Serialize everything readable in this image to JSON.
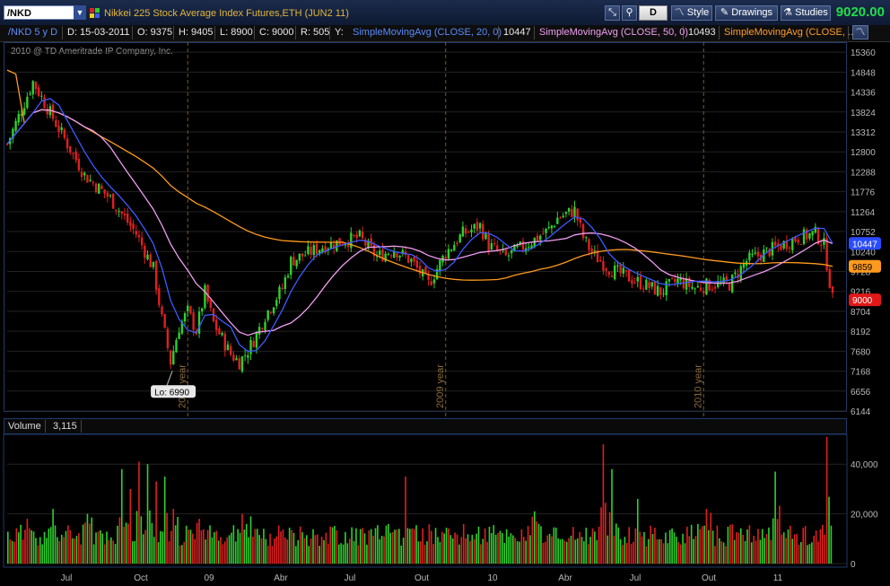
{
  "header": {
    "symbol": "/NKD",
    "title": "Nikkei 225 Stock Average Index Futures,ETH (JUN2 11)",
    "d_label": "D",
    "style_label": "Style",
    "drawings_label": "Drawings",
    "studies_label": "Studies",
    "last_price": "9020.00"
  },
  "info": {
    "period": "/NKD 5 y D",
    "date": "D: 15-03-2011",
    "open": "O: 9375",
    "high": "H: 9405",
    "low": "L: 8900",
    "close": "C: 9000",
    "range": "R: 505",
    "y": "Y:",
    "sma20_label": "SimpleMovingAvg (CLOSE, 20, 0)",
    "sma20_value": "10447",
    "sma50_label": "SimpleMovingAvg (CLOSE, 50, 0)",
    "sma50_value": "10493",
    "sma200_label": "SimpleMovingAvg (CLOSE, ..."
  },
  "copyright": "2010 @ TD Ameritrade IP Company, Inc.",
  "volume": {
    "label": "Volume",
    "value": "3,115"
  },
  "colors": {
    "up": "#2fd02f",
    "down": "#e02020",
    "sma20": "#3b5bff",
    "sma50": "#f09cf0",
    "sma200": "#ff9a1e",
    "grid": "#232323",
    "year_line": "#7a5a2a"
  },
  "chart_data": {
    "type": "candlestick",
    "price_axis_ticks": [
      6144,
      6656,
      7168,
      7680,
      8192,
      8704,
      9216,
      9728,
      10240,
      10752,
      11264,
      11776,
      12288,
      12800,
      13312,
      13824,
      14336,
      14848,
      15360
    ],
    "price_ylim": [
      6144,
      15616
    ],
    "x_ticks": [
      "Jul",
      "Oct",
      "09",
      "Abr",
      "Jul",
      "Out",
      "10",
      "Abr",
      "Jul",
      "Out",
      "11"
    ],
    "year_markers": [
      "2008 year",
      "2009 year",
      "2010 year"
    ],
    "low_annotation": "Lo: 6990",
    "close_key": [
      [
        0,
        13000
      ],
      [
        3,
        14600
      ],
      [
        6,
        13400
      ],
      [
        9,
        12200
      ],
      [
        12,
        11600
      ],
      [
        15,
        10700
      ],
      [
        17,
        9800
      ],
      [
        18,
        8500
      ],
      [
        19,
        7400
      ],
      [
        20,
        8300
      ],
      [
        21,
        8700
      ],
      [
        22,
        8200
      ],
      [
        23,
        9200
      ],
      [
        24,
        8400
      ],
      [
        25,
        8000
      ],
      [
        26,
        7600
      ],
      [
        27,
        7400
      ],
      [
        28,
        7700
      ],
      [
        29,
        8100
      ],
      [
        30,
        8600
      ],
      [
        32,
        9300
      ],
      [
        33,
        10000
      ],
      [
        35,
        10200
      ],
      [
        37,
        10400
      ],
      [
        39,
        10500
      ],
      [
        41,
        10600
      ],
      [
        43,
        10100
      ],
      [
        45,
        10300
      ],
      [
        47,
        10000
      ],
      [
        49,
        9400
      ],
      [
        51,
        10200
      ],
      [
        53,
        10700
      ],
      [
        55,
        10900
      ],
      [
        56,
        10400
      ],
      [
        58,
        10100
      ],
      [
        61,
        10500
      ],
      [
        63,
        10800
      ],
      [
        64,
        11100
      ],
      [
        66,
        11300
      ],
      [
        67,
        10600
      ],
      [
        68,
        10200
      ],
      [
        70,
        9800
      ],
      [
        72,
        9600
      ],
      [
        74,
        9400
      ],
      [
        76,
        9200
      ],
      [
        78,
        9500
      ],
      [
        80,
        9300
      ],
      [
        82,
        9400
      ],
      [
        84,
        9400
      ],
      [
        86,
        10000
      ],
      [
        88,
        10200
      ],
      [
        90,
        10400
      ],
      [
        92,
        10600
      ],
      [
        94,
        10700
      ],
      [
        95,
        10400
      ],
      [
        96,
        9000
      ]
    ],
    "sma20_last": 10447,
    "sma50_last": 10493,
    "sma200_last": 9859,
    "last_close": 9000,
    "price_labels": [
      {
        "value": 10447,
        "color": "#2a4cff",
        "text": "10447"
      },
      {
        "value": 9859,
        "color": "#ff9a1e",
        "text": "9859"
      },
      {
        "value": 9000,
        "color": "#e01818",
        "text": "9000"
      }
    ],
    "volume_ticks": [
      {
        "value": 0,
        "label": "0"
      },
      {
        "value": 20000,
        "label": "20,000"
      },
      {
        "value": 40000,
        "label": "40,000"
      }
    ],
    "volume_ylim": [
      0,
      52000
    ],
    "volume_spikes": [
      [
        2,
        18000
      ],
      [
        5,
        22000
      ],
      [
        9,
        20000
      ],
      [
        13,
        38000
      ],
      [
        14,
        30000
      ],
      [
        15,
        41000
      ],
      [
        16,
        40000
      ],
      [
        17,
        33000
      ],
      [
        18,
        35000
      ],
      [
        19,
        22000
      ],
      [
        22,
        18000
      ],
      [
        27,
        20000
      ],
      [
        28,
        19000
      ],
      [
        46,
        35000
      ],
      [
        61,
        21000
      ],
      [
        69,
        48000
      ],
      [
        70,
        38000
      ],
      [
        73,
        26000
      ],
      [
        81,
        22000
      ],
      [
        89,
        37000
      ],
      [
        95,
        51000
      ],
      [
        96,
        38000
      ]
    ]
  }
}
